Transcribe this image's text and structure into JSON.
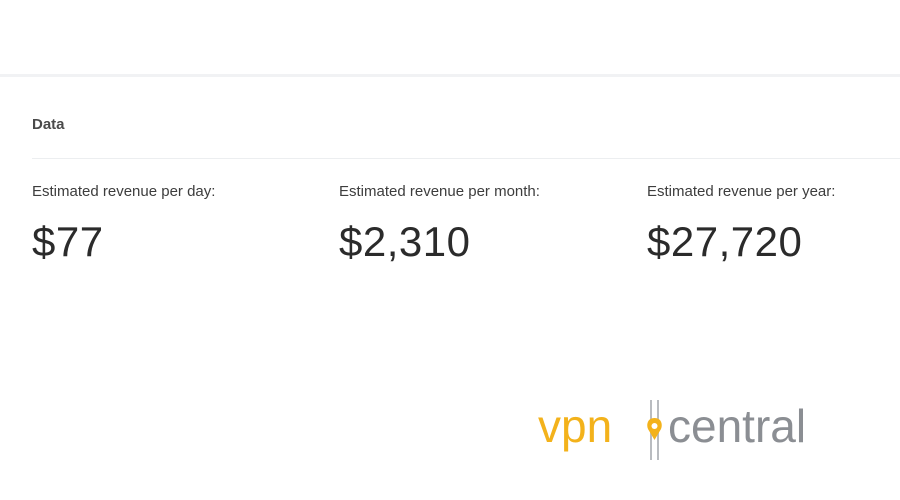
{
  "section": {
    "title": "Data"
  },
  "stats": [
    {
      "label": "Estimated revenue per day:",
      "value": "$77"
    },
    {
      "label": "Estimated revenue per month:",
      "value": "$2,310"
    },
    {
      "label": "Estimated revenue per year:",
      "value": "$27,720"
    }
  ],
  "watermark": {
    "brand_left": "vpn",
    "brand_right": "central",
    "colors": {
      "vpn": "#f3b21b",
      "central": "#8b8e93"
    }
  }
}
